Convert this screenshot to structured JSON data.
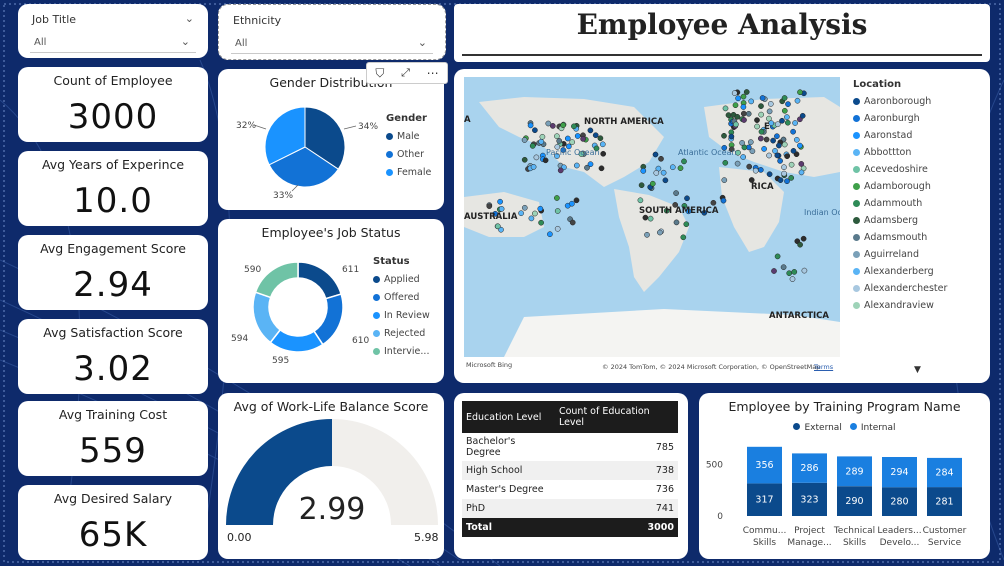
{
  "title": "Employee Analysis",
  "slicers": {
    "job_title": {
      "label": "Job Title",
      "value": "All"
    },
    "ethnicity": {
      "label": "Ethnicity",
      "value": "All"
    }
  },
  "kpis": [
    {
      "label": "Count of Employee",
      "value": "3000"
    },
    {
      "label": "Avg Years of Experince",
      "value": "10.0"
    },
    {
      "label": "Avg Engagement Score",
      "value": "2.94"
    },
    {
      "label": "Avg Satisfaction Score",
      "value": "3.02"
    },
    {
      "label": "Avg Training Cost",
      "value": "559"
    },
    {
      "label": "Avg Desired Salary",
      "value": "65K"
    }
  ],
  "gender": {
    "title": "Gender Distribution",
    "legend_title": "Gender",
    "items": [
      {
        "label": "Male",
        "pct": 34,
        "text": "34%",
        "color": "#0b4a8c"
      },
      {
        "label": "Other",
        "pct": 33,
        "text": "33%",
        "color": "#1272d6"
      },
      {
        "label": "Female",
        "pct": 32,
        "text": "32%",
        "color": "#1a93ff"
      }
    ]
  },
  "job_status": {
    "title": "Employee's Job Status",
    "legend_title": "Status",
    "items": [
      {
        "label": "Applied",
        "value": 611,
        "color": "#0b4a8c"
      },
      {
        "label": "Offered",
        "value": 610,
        "color": "#1272d6"
      },
      {
        "label": "In Review",
        "value": 595,
        "color": "#1a93ff"
      },
      {
        "label": "Rejected",
        "value": 594,
        "color": "#5ab4f5"
      },
      {
        "label": "Intervie...",
        "value": 590,
        "color": "#6fc3a6"
      }
    ]
  },
  "worklife": {
    "title": "Avg of Work-Life Balance Score",
    "value": 2.99,
    "value_text": "2.99",
    "min_text": "0.00",
    "max_text": "5.98",
    "color": "#0b4a8c"
  },
  "map": {
    "legend_title": "Location",
    "legend": [
      {
        "label": "Aaronborough",
        "color": "#0b4a8c"
      },
      {
        "label": "Aaronburgh",
        "color": "#1272d6"
      },
      {
        "label": "Aaronstad",
        "color": "#1a93ff"
      },
      {
        "label": "Abbottton",
        "color": "#5ab4f5"
      },
      {
        "label": "Acevedoshire",
        "color": "#6fc3a6"
      },
      {
        "label": "Adamborough",
        "color": "#3fa04a"
      },
      {
        "label": "Adammouth",
        "color": "#2e8b57"
      },
      {
        "label": "Adamsberg",
        "color": "#2d5a3d"
      },
      {
        "label": "Adamsmouth",
        "color": "#5a7a8c"
      },
      {
        "label": "Aguirreland",
        "color": "#7aa0b8"
      },
      {
        "label": "Alexanderberg",
        "color": "#5ab4f5"
      },
      {
        "label": "Alexanderchester",
        "color": "#a8c8e0"
      },
      {
        "label": "Alexandraview",
        "color": "#9ed3b8"
      }
    ],
    "labels": {
      "north_america": "NORTH AMERICA",
      "south_america": "SOUTH AMERICA",
      "australia": "AUSTRALIA",
      "antarctica": "ANTARCTICA",
      "pacific": "Pacific Ocean",
      "atlantic": "Atlantic Ocean",
      "indian": "Indian Ocean",
      "a_left": "A",
      "europe_e": "E",
      "africa_rica": "RICA"
    },
    "attribution": "© 2024 TomTom, © 2024 Microsoft Corporation, © OpenStreetMap",
    "terms": "Terms",
    "bing": "Microsoft Bing"
  },
  "education": {
    "headers": [
      "Education Level",
      "Count of Education Level"
    ],
    "rows": [
      {
        "level": "Bachelor's Degree",
        "count": "785"
      },
      {
        "level": "High School",
        "count": "738"
      },
      {
        "level": "Master's Degree",
        "count": "736"
      },
      {
        "level": "PhD",
        "count": "741"
      }
    ],
    "total_label": "Total",
    "total": "3000"
  },
  "chart_data": {
    "type": "bar",
    "title": "Employee by Training Program Name",
    "categories": [
      "Communication Skills",
      "Project Management",
      "Technical Skills",
      "Leadership Development",
      "Customer Service"
    ],
    "category_lines": [
      [
        "Commu...",
        "Skills"
      ],
      [
        "Project",
        "Manage..."
      ],
      [
        "Technical",
        "Skills"
      ],
      [
        "Leaders...",
        "Develo..."
      ],
      [
        "Customer",
        "Service"
      ]
    ],
    "series": [
      {
        "name": "External",
        "values": [
          317,
          323,
          290,
          280,
          281
        ],
        "color": "#0b4a8c"
      },
      {
        "name": "Internal",
        "values": [
          356,
          286,
          289,
          294,
          284
        ],
        "color": "#1a7fe0"
      }
    ],
    "stacked": true,
    "yticks": [
      "0",
      "500"
    ],
    "ylim": [
      0,
      700
    ],
    "legend_position": "top"
  }
}
